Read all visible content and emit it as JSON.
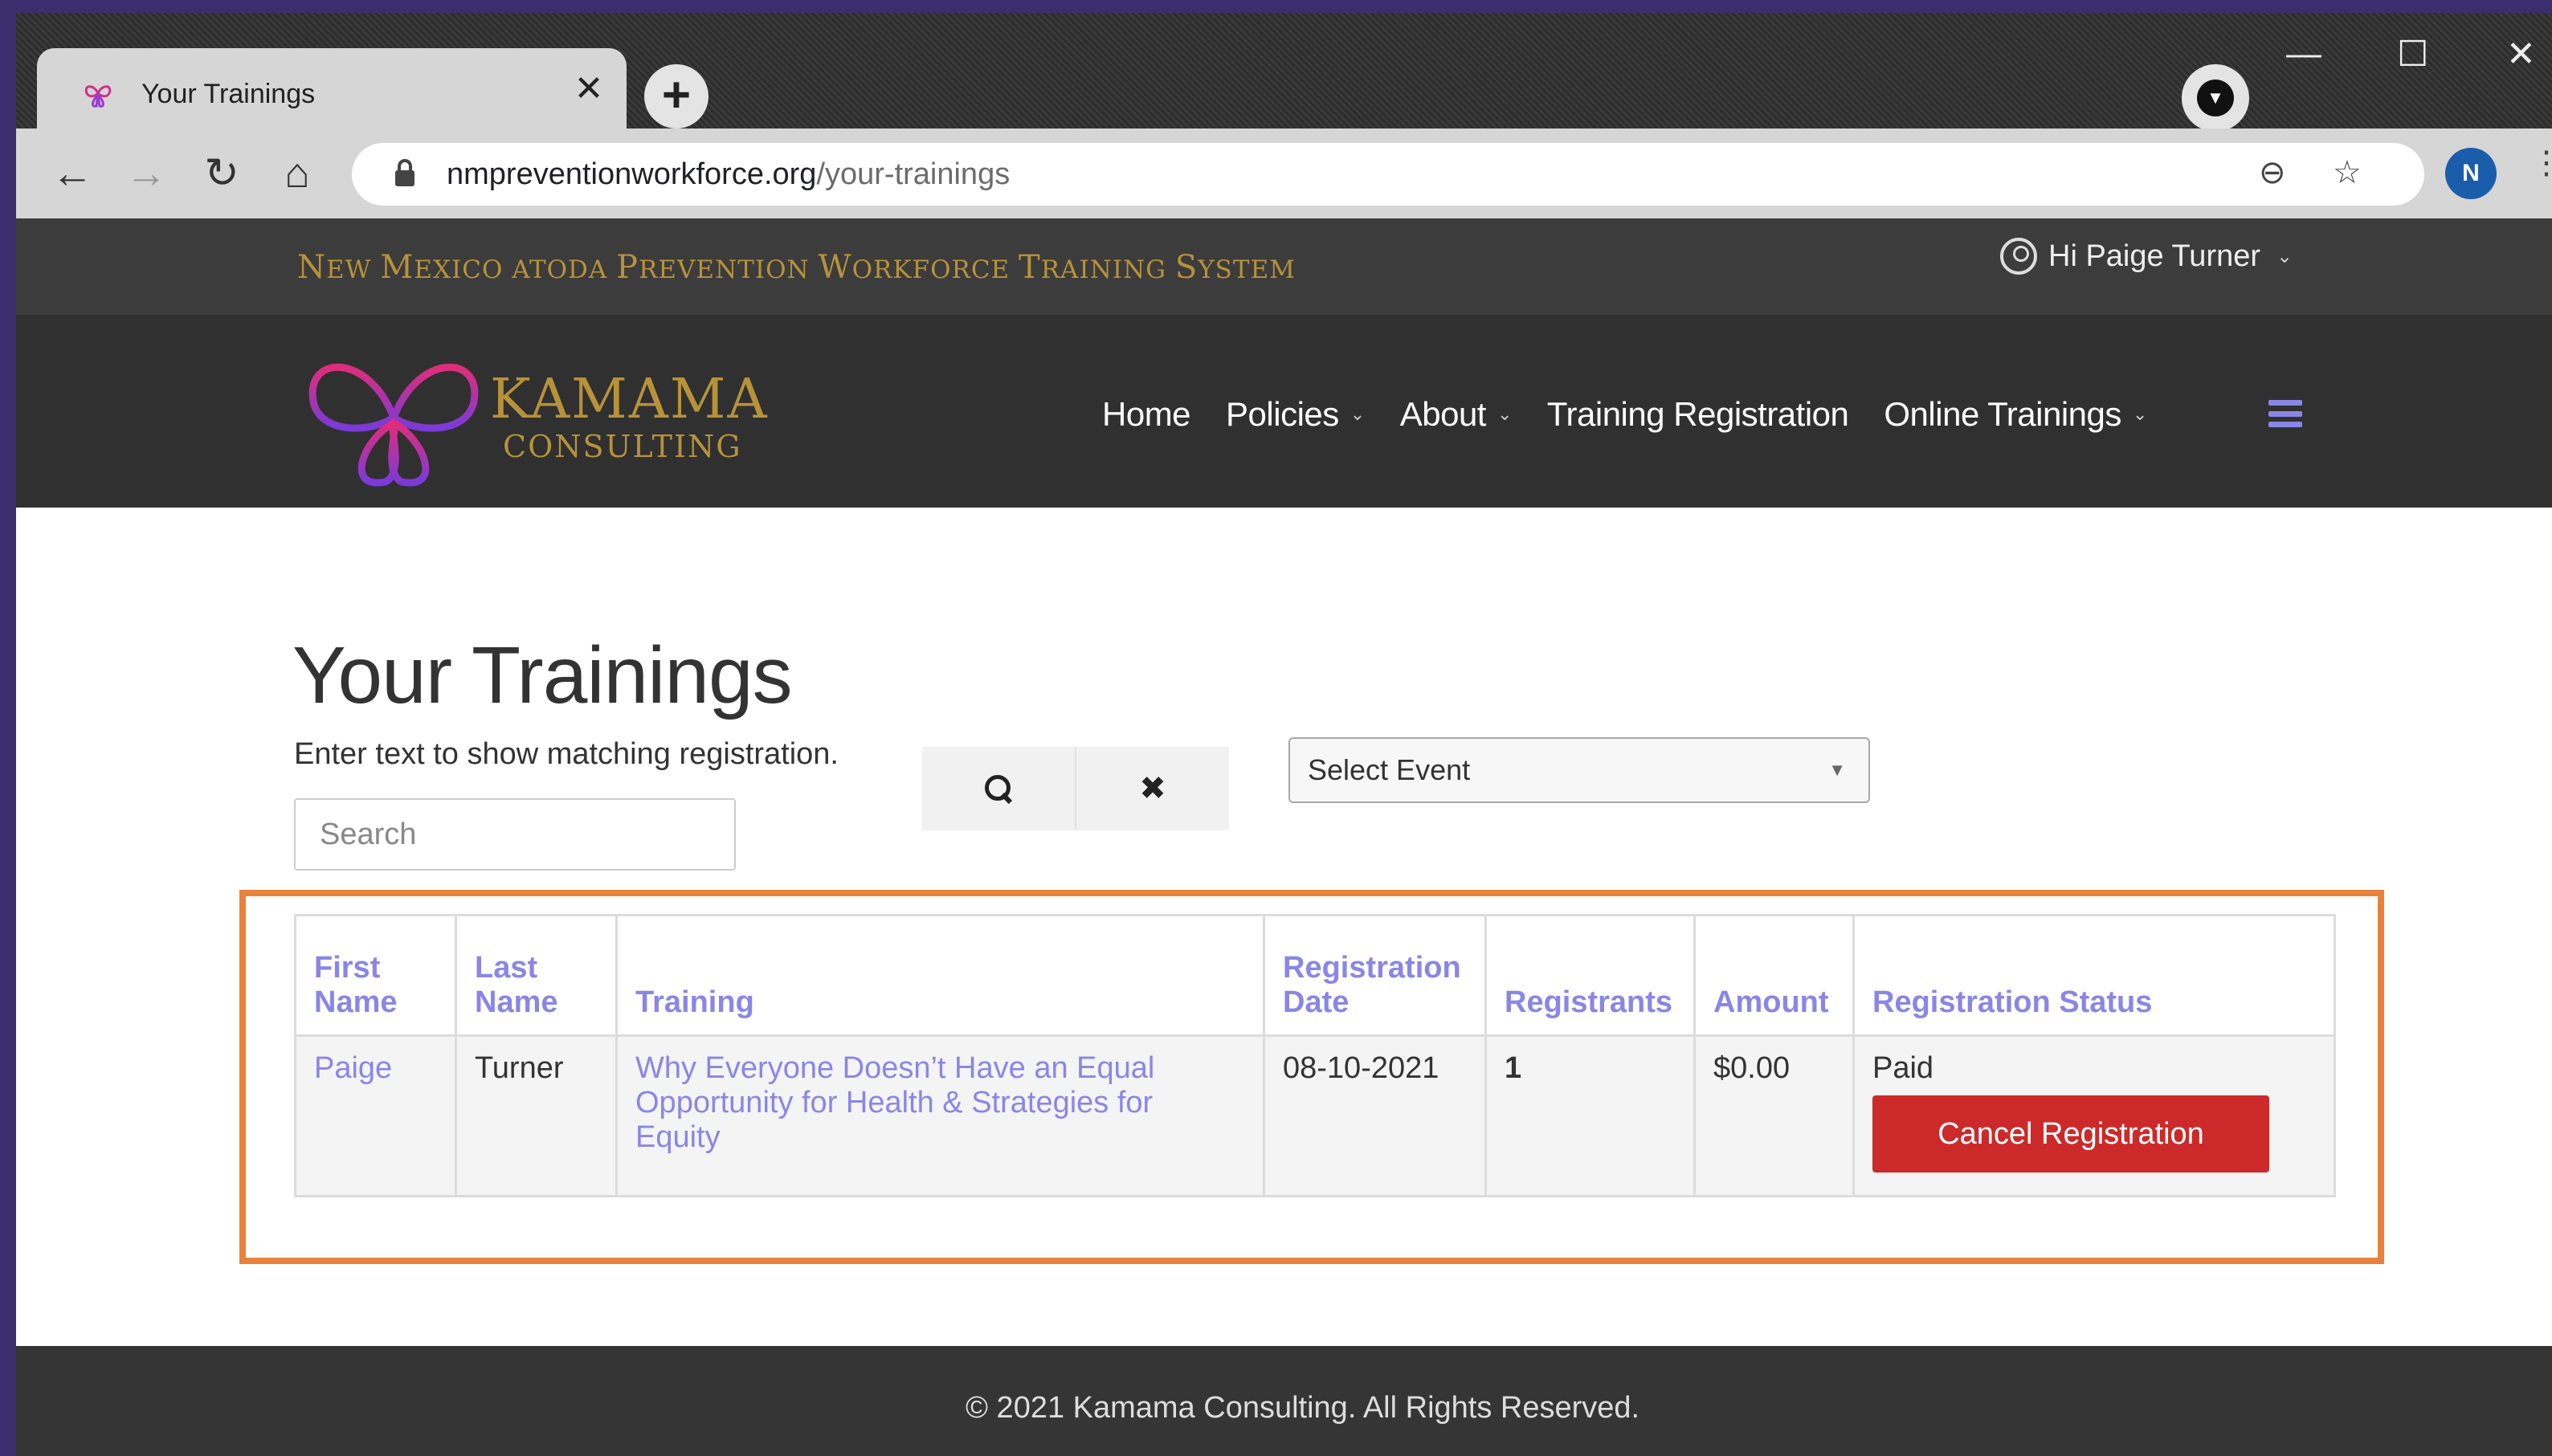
{
  "browser": {
    "tab_title": "Your Trainings",
    "tab_close": "✕",
    "new_tab": "+",
    "url_domain": "nmpreventionworkforce.org",
    "url_path": "/your-trainings",
    "profile_initial": "N",
    "window_controls": {
      "minimize": "—",
      "maximize": "☐",
      "close": "✕"
    },
    "icons": [
      "back-icon",
      "forward-icon",
      "reload-icon",
      "home-icon",
      "lock-icon",
      "zoom-icon",
      "star-icon",
      "menu-kebab-icon"
    ]
  },
  "site": {
    "tagline": [
      "N",
      "EW ",
      "M",
      "EXICO ",
      "ATODA ",
      "P",
      "REVENTION ",
      "W",
      "ORKFORCE ",
      "T",
      "RAINING ",
      "S",
      "YSTEM"
    ],
    "greeting": "Hi Paige Turner",
    "logo_line1": "KAMAMA",
    "logo_line2": "CONSULTING",
    "colors": {
      "gold": "#b7923a",
      "accent": "#8a86e6",
      "danger": "#cc2a2a",
      "highlight": "#e8823a"
    },
    "nav": [
      {
        "label": "Home",
        "dropdown": false
      },
      {
        "label": "Policies",
        "dropdown": true
      },
      {
        "label": "About",
        "dropdown": true
      },
      {
        "label": "Training Registration",
        "dropdown": false
      },
      {
        "label": "Online Trainings",
        "dropdown": true
      }
    ]
  },
  "main": {
    "title": "Your Trainings",
    "hint": "Enter text to show matching registration.",
    "search_placeholder": "Search",
    "clear_label": "✖",
    "select_event": "Select Event",
    "table": {
      "headers": [
        "First Name",
        "Last Name",
        "Training",
        "Registration Date",
        "Registrants",
        "Amount",
        "Registration Status"
      ],
      "rows": [
        {
          "first_name": "Paige",
          "last_name": "Turner",
          "training": "Why Everyone Doesn’t Have an Equal Opportunity for Health & Strategies for Equity",
          "registration_date": "08-10-2021",
          "registrants": "1",
          "amount": "$0.00",
          "status": "Paid",
          "action": "Cancel Registration"
        }
      ]
    }
  },
  "footer": {
    "text": "© 2021 Kamama Consulting. All Rights Reserved."
  }
}
